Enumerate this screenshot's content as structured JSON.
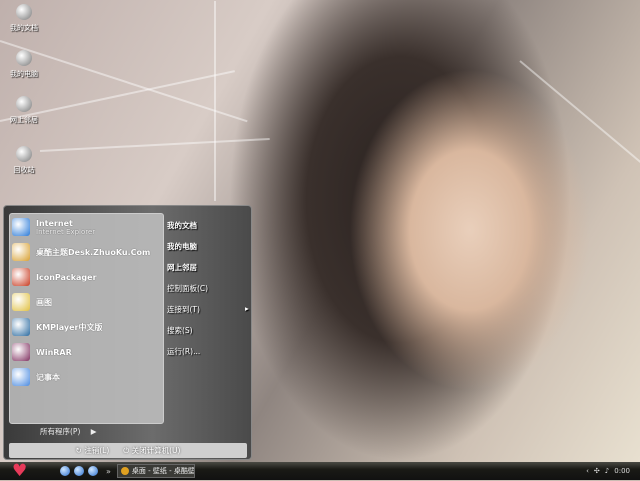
{
  "desktop_icons": [
    {
      "label": "我的文档",
      "icon": "documents-icon"
    },
    {
      "label": "我的电脑",
      "icon": "computer-icon"
    },
    {
      "label": "网上邻居",
      "icon": "network-icon"
    },
    {
      "label": "回收站",
      "icon": "recycle-bin-icon"
    }
  ],
  "start_menu": {
    "programs": [
      {
        "label": "Internet",
        "sub": "Internet Explorer",
        "color": "#2a7ad8"
      },
      {
        "label": "桌酷主题Desk.ZhuoKu.Com",
        "color": "#d8a030"
      },
      {
        "label": "IconPackager",
        "color": "#c83a20"
      },
      {
        "label": "画图",
        "color": "#e0c040"
      },
      {
        "label": "KMPlayer中文版",
        "color": "#2a6aa0"
      },
      {
        "label": "WinRAR",
        "color": "#803060"
      },
      {
        "label": "记事本",
        "color": "#4a8ae0"
      }
    ],
    "places": [
      {
        "label": "我的文档",
        "bold": true
      },
      {
        "label": "我的电脑",
        "bold": true
      },
      {
        "label": "网上邻居",
        "bold": true
      },
      {
        "label": "控制面板(C)"
      },
      {
        "label": "连接到(T)",
        "arrow": "▸"
      },
      {
        "label": "搜索(S)"
      },
      {
        "label": "运行(R)..."
      }
    ],
    "all_programs": "所有程序(P)",
    "all_programs_arrow": "▶",
    "logoff": "注销(L)",
    "shutdown": "关闭计算机(U)"
  },
  "taskbar": {
    "start_icon": "♥",
    "chevron": "»",
    "task": "桌面 - 壁纸 - 桌酷壁...",
    "clock": "0:00",
    "tray_arrow": "‹"
  }
}
